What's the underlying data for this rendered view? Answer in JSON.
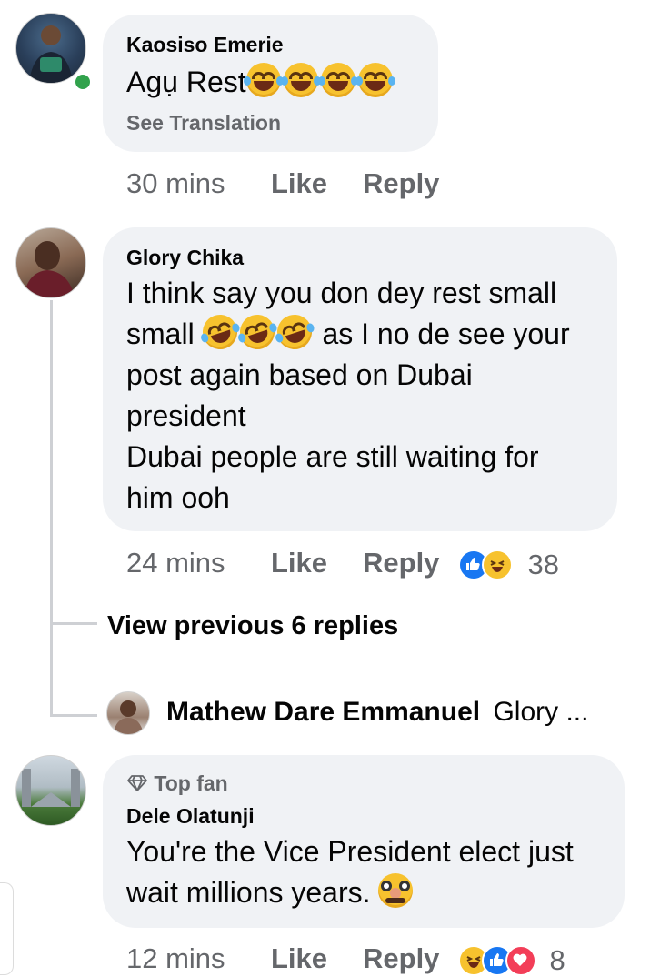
{
  "comments": [
    {
      "author": "Kaosiso Emerie",
      "text": "Agụ Rest",
      "see_translation": "See Translation",
      "time": "30 mins",
      "like": "Like",
      "reply": "Reply"
    },
    {
      "author": "Glory Chika",
      "text_line1": "I think say you don dey rest small",
      "text_line2a": "small",
      "text_line2b": "as I no de see your",
      "text_line3": "post again based on Dubai",
      "text_line4": "president",
      "text_line5": "Dubai people are still waiting for",
      "text_line6": "him ooh",
      "time": "24 mins",
      "like": "Like",
      "reply": "Reply",
      "reaction_count": "38"
    },
    {
      "badge": "Top fan",
      "author": "Dele Olatunji",
      "text_line1": "You're the Vice President elect just",
      "text_line2": "wait millions years.",
      "time": "12 mins",
      "like": "Like",
      "reply": "Reply",
      "reaction_count": "8"
    }
  ],
  "thread": {
    "view_previous": "View previous 6 replies",
    "reply_author": "Mathew Dare Emmanuel",
    "reply_preview": "Glory ..."
  },
  "icons": [
    "laugh-cry-emoji",
    "rolling-laugh-emoji",
    "like-reaction-icon",
    "haha-reaction-icon",
    "love-reaction-icon",
    "diamond-icon",
    "disguise-emoji",
    "online-status-icon"
  ],
  "colors": {
    "bubble": "#f0f2f5",
    "meta": "#65676b",
    "online": "#31a24c",
    "like": "#1877f2",
    "love": "#f33e58"
  }
}
